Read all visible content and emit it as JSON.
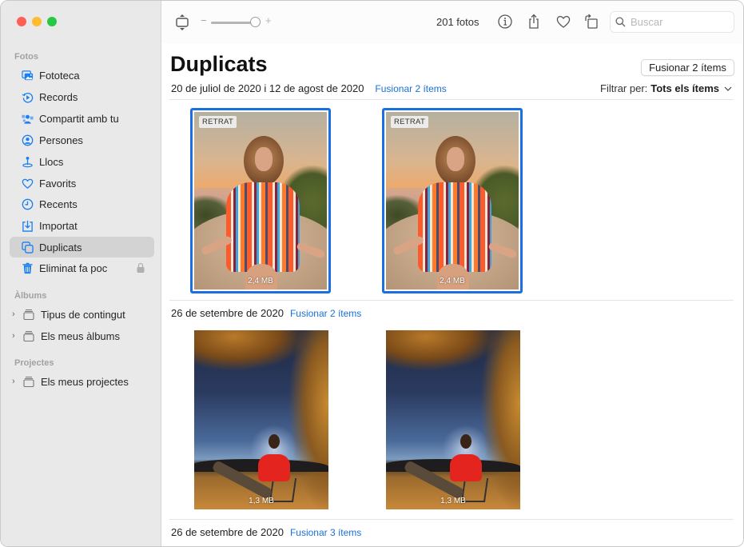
{
  "window": {
    "traffic_lights": [
      "close",
      "minimize",
      "zoom"
    ]
  },
  "sidebar": {
    "sections": [
      {
        "label": "Fotos"
      },
      {
        "label": "Àlbums"
      },
      {
        "label": "Projectes"
      }
    ],
    "items": [
      {
        "label": "Fototeca",
        "icon": "photo-library-icon"
      },
      {
        "label": "Records",
        "icon": "memories-icon"
      },
      {
        "label": "Compartit amb tu",
        "icon": "shared-with-you-icon"
      },
      {
        "label": "Persones",
        "icon": "people-icon"
      },
      {
        "label": "Llocs",
        "icon": "places-icon"
      },
      {
        "label": "Favorits",
        "icon": "heart-icon"
      },
      {
        "label": "Recents",
        "icon": "clock-icon"
      },
      {
        "label": "Importat",
        "icon": "import-icon"
      },
      {
        "label": "Duplicats",
        "icon": "duplicates-icon",
        "active": true
      },
      {
        "label": "Eliminat fa poc",
        "icon": "trash-icon",
        "locked": true
      }
    ],
    "albums": [
      {
        "label": "Tipus de contingut"
      },
      {
        "label": "Els meus àlbums"
      }
    ],
    "projects": [
      {
        "label": "Els meus projectes"
      }
    ]
  },
  "toolbar": {
    "zoom_minus": "−",
    "zoom_plus": "+",
    "zoom_level": 0.85,
    "photo_count": "201 fotos",
    "search_placeholder": "Buscar",
    "search_value": ""
  },
  "main": {
    "title": "Duplicats",
    "merge_all_button": "Fusionar 2 ítems",
    "filter_label": "Filtrar per:",
    "filter_value": "Tots els ítems",
    "groups": [
      {
        "date": "20 de juliol de 2020 i 12 de agost de 2020",
        "merge_link": "Fusionar 2 ítems",
        "photos": [
          {
            "badge": "RETRAT",
            "size": "2,4 MB",
            "selected": true
          },
          {
            "badge": "RETRAT",
            "size": "2,4 MB",
            "selected": true
          }
        ]
      },
      {
        "date": "26 de setembre de 2020",
        "merge_link": "Fusionar 2 ítems",
        "photos": [
          {
            "size": "1,3 MB",
            "selected": false
          },
          {
            "size": "1,3 MB",
            "selected": false
          }
        ]
      },
      {
        "date": "26 de setembre de 2020",
        "merge_link": "Fusionar 3 ítems"
      }
    ]
  },
  "colors": {
    "accent": "#1b6fe3",
    "link": "#1a70d6",
    "sidebar_bg": "#e9e9e9",
    "sidebar_active": "#d3d3d3"
  }
}
